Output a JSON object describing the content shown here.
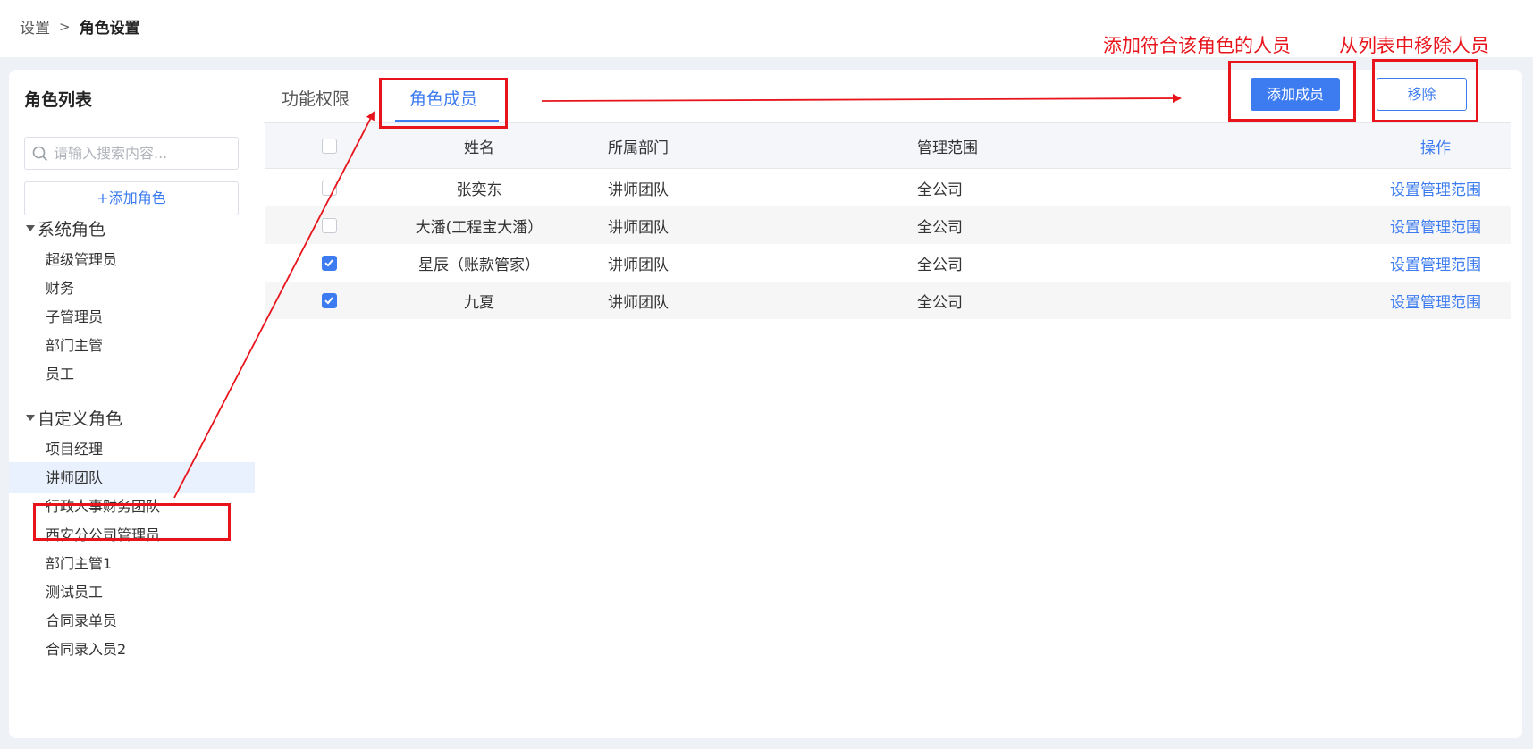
{
  "breadcrumb": {
    "parent": "设置",
    "separator": ">",
    "current": "角色设置"
  },
  "sidebar": {
    "title": "角色列表",
    "search_placeholder": "请输入搜索内容...",
    "add_role_label": "+添加角色",
    "groups": [
      {
        "label": "系统角色",
        "items": [
          "超级管理员",
          "财务",
          "子管理员",
          "部门主管",
          "员工"
        ]
      },
      {
        "label": "自定义角色",
        "items": [
          "项目经理",
          "讲师团队",
          "行政人事财务团队",
          "西安分公司管理员",
          "部门主管1",
          "测试员工",
          "合同录单员",
          "合同录入员2"
        ]
      }
    ],
    "active_item": "讲师团队"
  },
  "tabs": [
    {
      "label": "功能权限",
      "active": false
    },
    {
      "label": "角色成员",
      "active": true
    }
  ],
  "actions": {
    "add_member_label": "添加成员",
    "remove_label": "移除"
  },
  "table": {
    "headers": {
      "name": "姓名",
      "dept": "所属部门",
      "scope": "管理范围",
      "op": "操作"
    },
    "rows": [
      {
        "checked": false,
        "name": "张奕东",
        "dept": "讲师团队",
        "scope": "全公司",
        "op": "设置管理范围"
      },
      {
        "checked": false,
        "name": "大潘(工程宝大潘）",
        "dept": "讲师团队",
        "scope": "全公司",
        "op": "设置管理范围"
      },
      {
        "checked": true,
        "name": "星辰（账款管家）",
        "dept": "讲师团队",
        "scope": "全公司",
        "op": "设置管理范围"
      },
      {
        "checked": true,
        "name": "九夏",
        "dept": "讲师团队",
        "scope": "全公司",
        "op": "设置管理范围"
      }
    ]
  },
  "annotations": {
    "add_note": "添加符合该角色的人员",
    "remove_note": "从列表中移除人员"
  },
  "colors": {
    "accent": "#3d7cf0",
    "annotation": "#e8141c",
    "active_bg": "#e8f1fd"
  }
}
